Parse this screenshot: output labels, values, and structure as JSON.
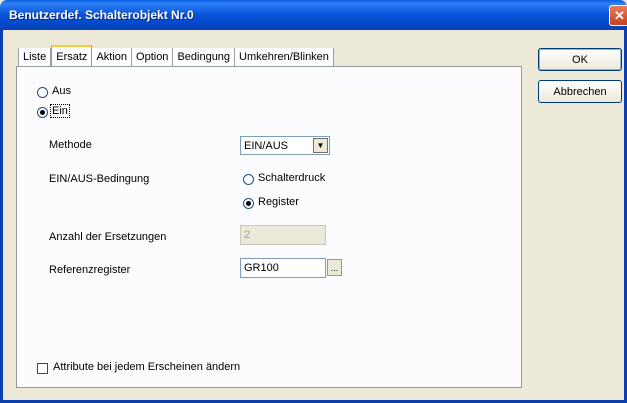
{
  "window": {
    "title": "Benutzerdef. Schalterobjekt Nr.0",
    "close_symbol": "✕"
  },
  "tabs": [
    {
      "label": "Liste",
      "active": false
    },
    {
      "label": "Ersatz",
      "active": true
    },
    {
      "label": "Aktion",
      "active": false
    },
    {
      "label": "Option",
      "active": false
    },
    {
      "label": "Bedingung",
      "active": false
    },
    {
      "label": "Umkehren/Blinken",
      "active": false
    }
  ],
  "buttons": {
    "ok": "OK",
    "cancel": "Abbrechen"
  },
  "mode": {
    "options": [
      {
        "label": "Aus",
        "selected": false
      },
      {
        "label": "Ein",
        "selected": true
      }
    ]
  },
  "methode": {
    "label": "Methode",
    "value": "EIN/AUS"
  },
  "condition": {
    "label": "EIN/AUS-Bedingung",
    "options": [
      {
        "label": "Schalterdruck",
        "selected": false
      },
      {
        "label": "Register",
        "selected": true
      }
    ]
  },
  "replacements": {
    "label": "Anzahl der Ersetzungen",
    "value": "2"
  },
  "reference": {
    "label": "Referenzregister",
    "value": "GR100",
    "browse_label": "..."
  },
  "attribute_checkbox": {
    "label": "Attribute bei jedem Erscheinen ändern",
    "checked": false
  }
}
